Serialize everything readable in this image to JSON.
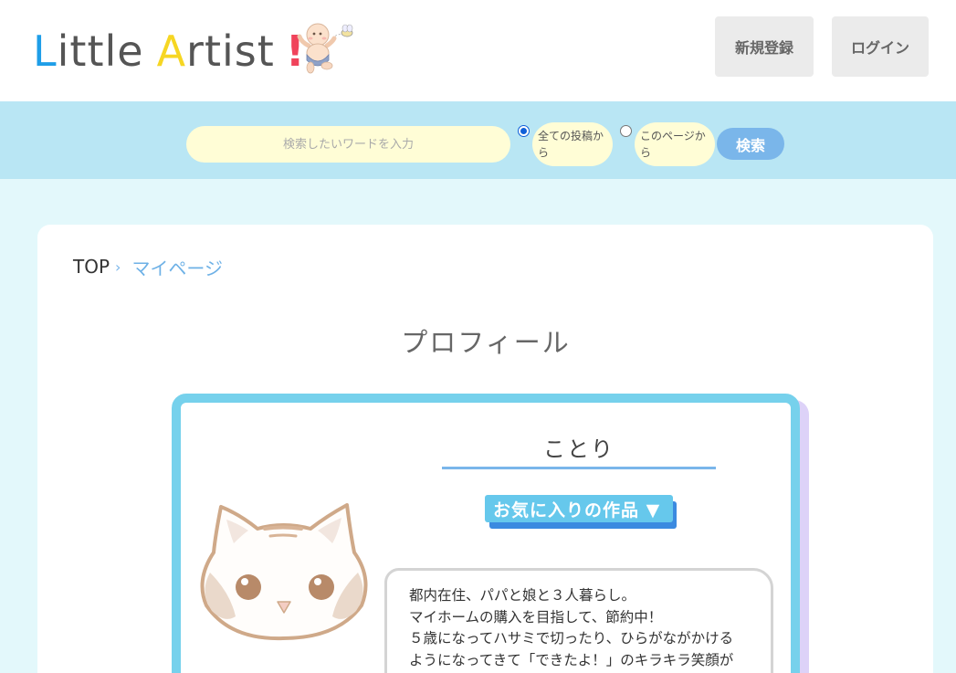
{
  "header": {
    "logo": {
      "first_letter": "L",
      "word1_rest": "ittle",
      "second_letter": "A",
      "word2_rest": "rtist",
      "exclaim": "!"
    },
    "logo_icon": "baby-with-bee-icon",
    "register_label": "新規登録",
    "login_label": "ログイン"
  },
  "search": {
    "placeholder": "検索したいワードを入力",
    "radio_all_label": "全ての投稿から",
    "radio_page_label": "このページから",
    "selected": "all",
    "button_label": "検索"
  },
  "breadcrumb": {
    "top": "TOP",
    "separator": "›",
    "current": "マイページ"
  },
  "page_title": "プロフィール",
  "profile": {
    "username": "ことり",
    "avatar_icon": "white-cat-avatar-icon",
    "favorites_label": "お気に入りの作品 ▼",
    "bio_lines": [
      "都内在住、パパと娘と３人暮らし。",
      "マイホームの購入を目指して、節約中！",
      "５歳になってハサミで切ったり、ひらがながかける",
      "ようになってきて「できたよ！」のキラキラ笑顔が"
    ]
  },
  "colors": {
    "logo_blue": "#1e9ee8",
    "logo_yellow": "#f6d623",
    "logo_red": "#f0435b",
    "search_band": "#b9e6f4",
    "input_bg": "#fffdd6",
    "accent_blue": "#7ab6ea",
    "frame_cyan": "#76d1ec",
    "frame_shadow_lavender": "#ddd2f8",
    "page_bg": "#e3f8fb"
  }
}
